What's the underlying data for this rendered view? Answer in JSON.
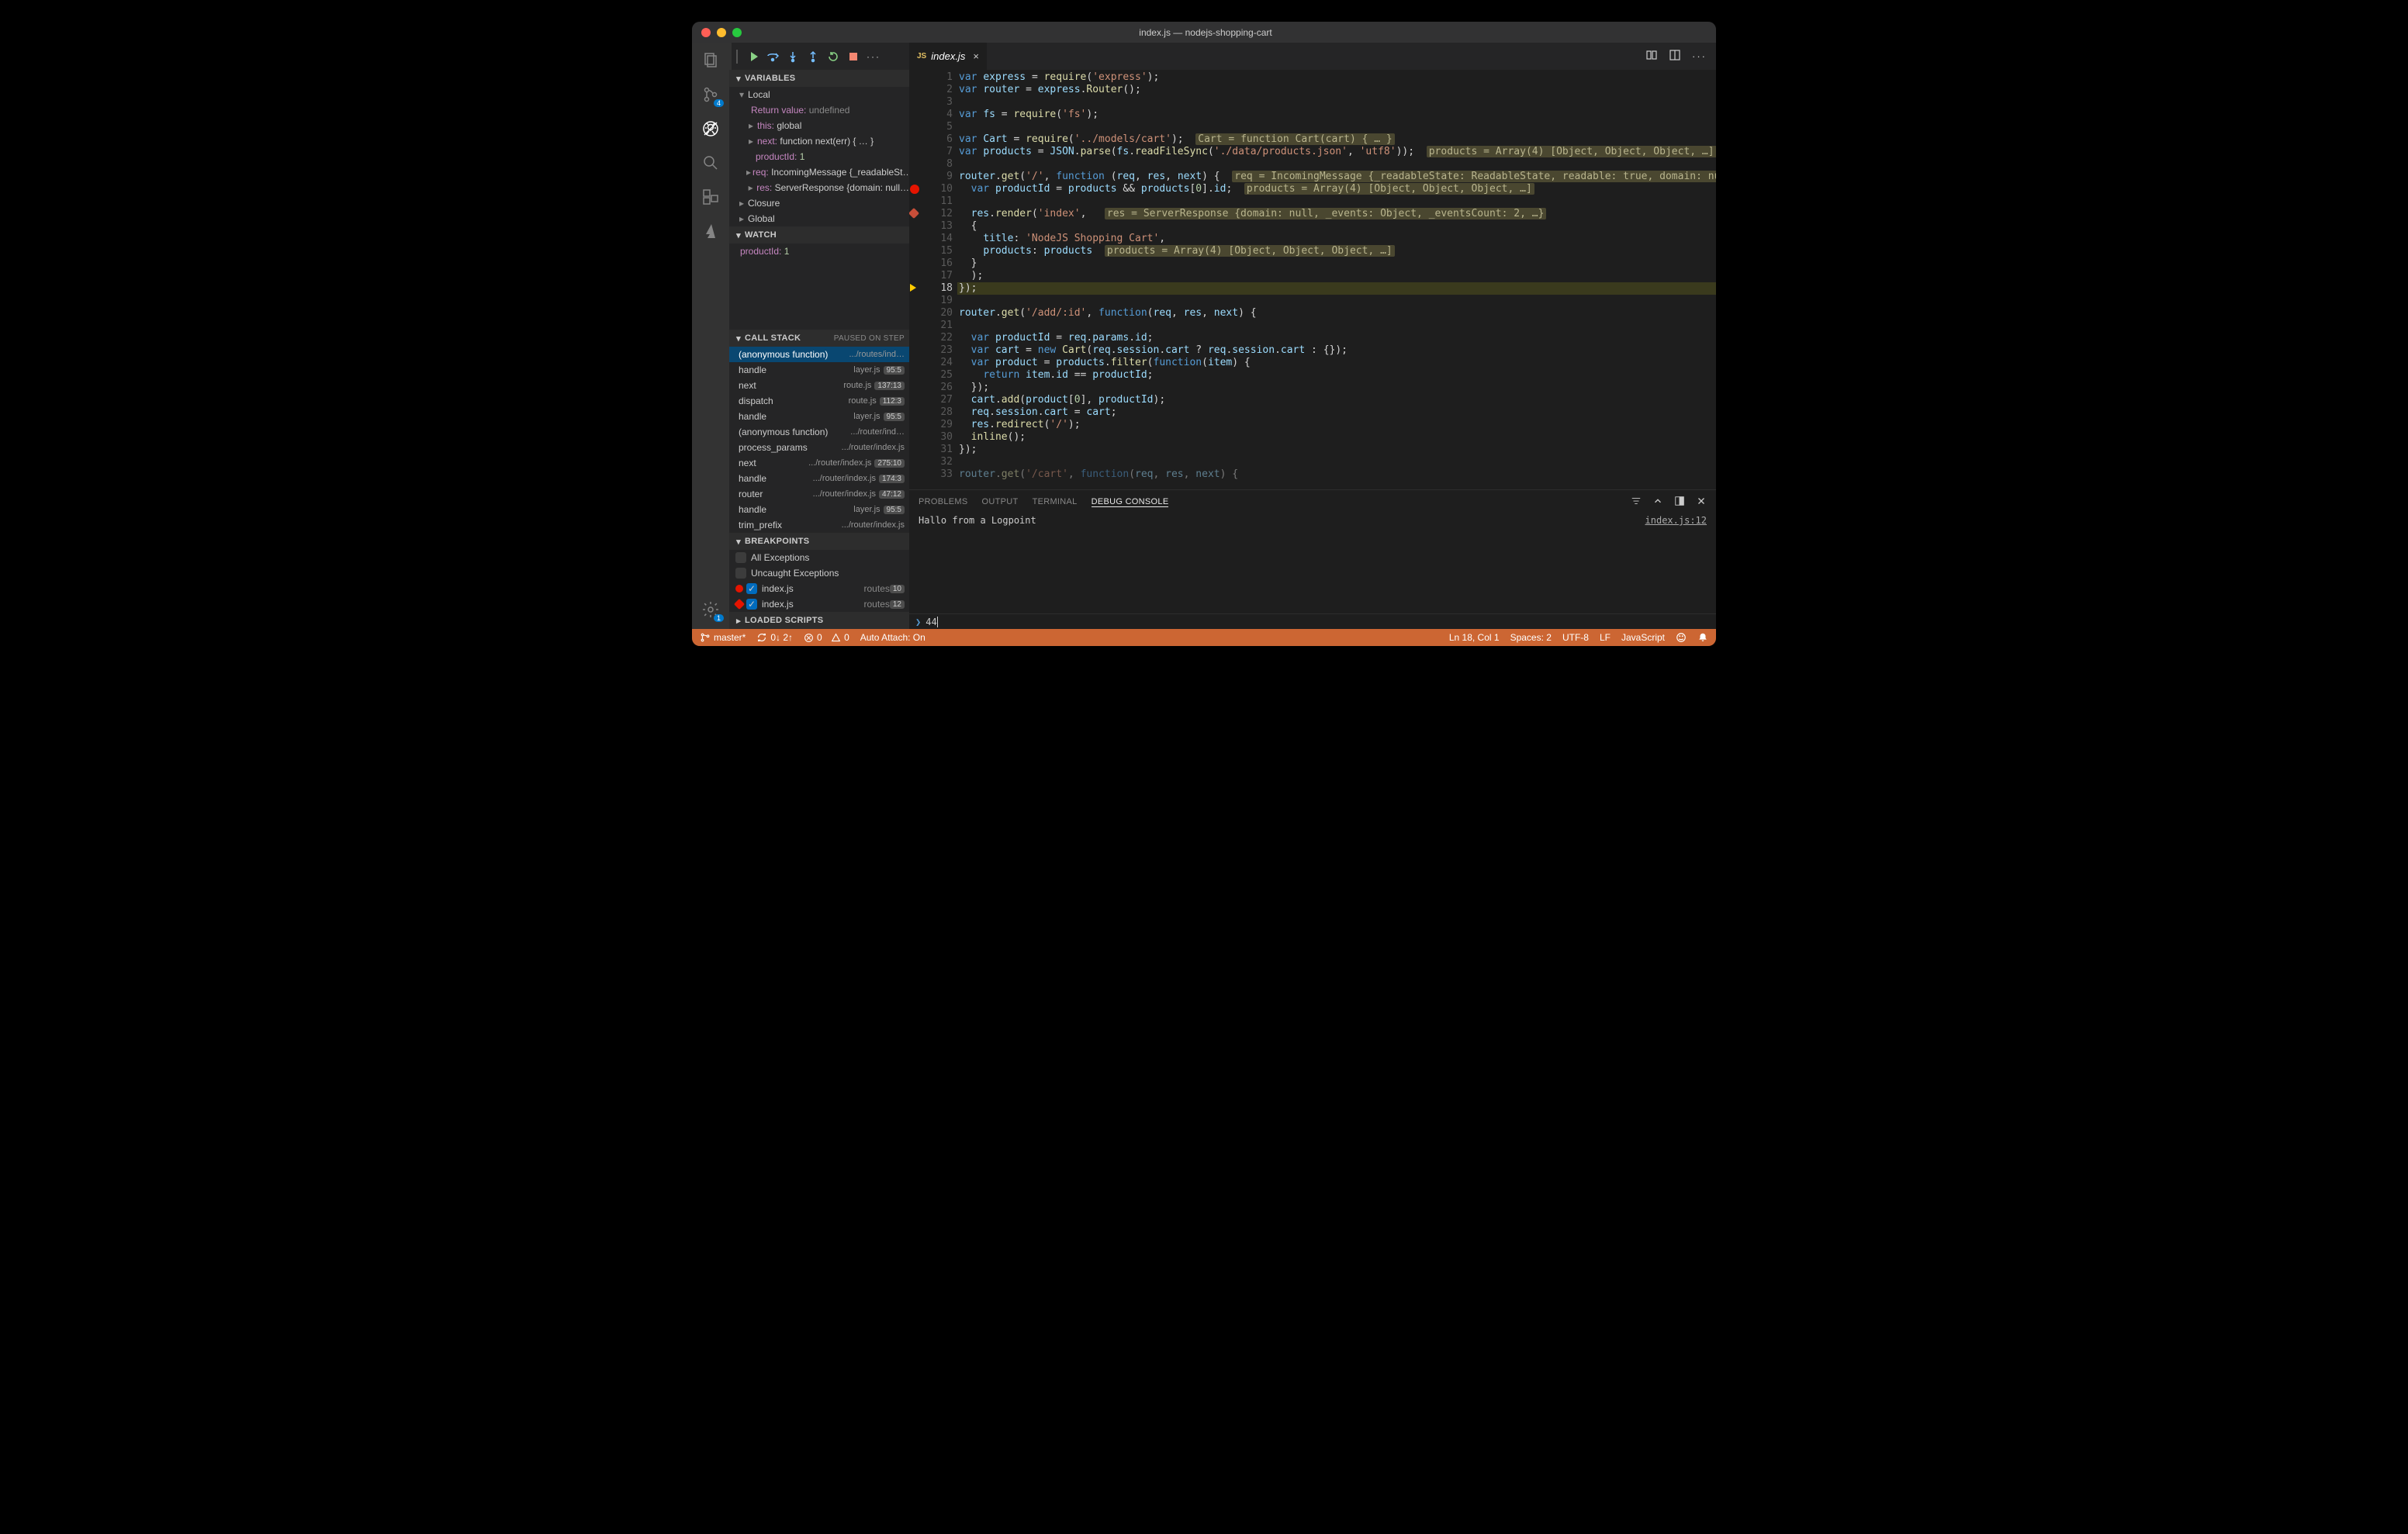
{
  "window": {
    "title": "index.js — nodejs-shopping-cart"
  },
  "activitybar": {
    "scm_badge": "4",
    "settings_badge": "1"
  },
  "debug_toolbar": {
    "more": "···"
  },
  "sidebar": {
    "variables": {
      "label": "VARIABLES",
      "local": "Local",
      "return_label": "Return value:",
      "return_val": "undefined",
      "this_label": "this:",
      "this_val": "global",
      "next_label": "next:",
      "next_val": "function next(err) { … }",
      "productId_label": "productId:",
      "productId_val": "1",
      "req_label": "req:",
      "req_val": "IncomingMessage {_readableSt…",
      "res_label": "res:",
      "res_val": "ServerResponse {domain: null…",
      "closure": "Closure",
      "global": "Global"
    },
    "watch": {
      "label": "WATCH",
      "item_name": "productId:",
      "item_val": "1"
    },
    "callstack": {
      "label": "CALL STACK",
      "aux": "PAUSED ON STEP",
      "rows": [
        {
          "fn": "(anonymous function)",
          "file": ".../routes/ind…",
          "ln": ""
        },
        {
          "fn": "handle",
          "file": "layer.js",
          "ln": "95:5"
        },
        {
          "fn": "next",
          "file": "route.js",
          "ln": "137:13"
        },
        {
          "fn": "dispatch",
          "file": "route.js",
          "ln": "112:3"
        },
        {
          "fn": "handle",
          "file": "layer.js",
          "ln": "95:5"
        },
        {
          "fn": "(anonymous function)",
          "file": ".../router/ind…",
          "ln": ""
        },
        {
          "fn": "process_params",
          "file": ".../router/index.js",
          "ln": ""
        },
        {
          "fn": "next",
          "file": ".../router/index.js",
          "ln": "275:10"
        },
        {
          "fn": "handle",
          "file": ".../router/index.js",
          "ln": "174:3"
        },
        {
          "fn": "router",
          "file": ".../router/index.js",
          "ln": "47:12"
        },
        {
          "fn": "handle",
          "file": "layer.js",
          "ln": "95:5"
        },
        {
          "fn": "trim_prefix",
          "file": ".../router/index.js",
          "ln": ""
        }
      ]
    },
    "breakpoints": {
      "label": "BREAKPOINTS",
      "all": "All Exceptions",
      "uncaught": "Uncaught Exceptions",
      "bp1_file": "index.js",
      "bp1_sub": "routes",
      "bp1_ln": "10",
      "bp2_file": "index.js",
      "bp2_sub": "routes",
      "bp2_ln": "12"
    },
    "loaded_scripts": "LOADED SCRIPTS"
  },
  "tab": {
    "js": "JS",
    "name": "index.js",
    "close": "×"
  },
  "editor": {
    "lines": [
      {
        "n": "1",
        "html": "<span class='kw'>var</span> <span class='ident'>express</span> <span class='punc'>=</span> <span class='fncall'>require</span><span class='punc'>(</span><span class='str'>'express'</span><span class='punc'>);</span>"
      },
      {
        "n": "2",
        "html": "<span class='kw'>var</span> <span class='ident'>router</span> <span class='punc'>=</span> <span class='ident'>express</span><span class='punc'>.</span><span class='fncall'>Router</span><span class='punc'>();</span>"
      },
      {
        "n": "3",
        "html": ""
      },
      {
        "n": "4",
        "html": "<span class='kw'>var</span> <span class='ident'>fs</span> <span class='punc'>=</span> <span class='fncall'>require</span><span class='punc'>(</span><span class='str'>'fs'</span><span class='punc'>);</span>"
      },
      {
        "n": "5",
        "html": ""
      },
      {
        "n": "6",
        "html": "<span class='kw'>var</span> <span class='ident'>Cart</span> <span class='punc'>=</span> <span class='fncall'>require</span><span class='punc'>(</span><span class='str'>'../models/cart'</span><span class='punc'>);</span>  <span class='inlay'>Cart = function Cart(cart) { … }</span>"
      },
      {
        "n": "7",
        "html": "<span class='kw'>var</span> <span class='ident'>products</span> <span class='punc'>=</span> <span class='ident'>JSON</span><span class='punc'>.</span><span class='fncall'>parse</span><span class='punc'>(</span><span class='ident'>fs</span><span class='punc'>.</span><span class='fncall'>readFileSync</span><span class='punc'>(</span><span class='str'>'./data/products.json'</span><span class='punc'>,</span> <span class='str'>'utf8'</span><span class='punc'>));</span>  <span class='inlay'>products = Array(4) [Object, Object, Object, …]</span>"
      },
      {
        "n": "8",
        "html": ""
      },
      {
        "n": "9",
        "html": "<span class='ident'>router</span><span class='punc'>.</span><span class='fncall'>get</span><span class='punc'>(</span><span class='str'>'/'</span><span class='punc'>,</span> <span class='kw'>function</span> <span class='punc'>(</span><span class='ident'>req</span><span class='punc'>,</span> <span class='ident'>res</span><span class='punc'>,</span> <span class='ident'>next</span><span class='punc'>) {</span>  <span class='inlay'>req = IncomingMessage {_readableState: ReadableState, readable: true, domain: null, …}, res = ServerRes</span>"
      },
      {
        "n": "10",
        "html": "  <span class='kw'>var</span> <span class='ident'>productId</span> <span class='punc'>=</span> <span class='ident'>products</span> <span class='punc'>&amp;&amp;</span> <span class='ident'>products</span><span class='punc'>[</span><span class='num'>0</span><span class='punc'>].</span><span class='ident'>id</span><span class='punc'>;</span>  <span class='inlay'>products = Array(4) [Object, Object, Object, …]</span>"
      },
      {
        "n": "11",
        "html": ""
      },
      {
        "n": "12",
        "html": "  <span class='ident'>res</span><span class='punc'>.</span><span class='fncall'>render</span><span class='punc'>(</span><span class='str'>'index'</span><span class='punc'>,</span>   <span class='inlay'>res = ServerResponse {domain: null, _events: Object, _eventsCount: 2, …}</span>"
      },
      {
        "n": "13",
        "html": "  <span class='punc'>{</span>"
      },
      {
        "n": "14",
        "html": "    <span class='ident'>title</span><span class='punc'>:</span> <span class='str'>'NodeJS Shopping Cart'</span><span class='punc'>,</span>"
      },
      {
        "n": "15",
        "html": "    <span class='ident'>products</span><span class='punc'>:</span> <span class='ident'>products</span>  <span class='inlay'>products = Array(4) [Object, Object, Object, …]</span>"
      },
      {
        "n": "16",
        "html": "  <span class='punc'>}</span>"
      },
      {
        "n": "17",
        "html": "  <span class='punc'>);</span>"
      },
      {
        "n": "18",
        "html": "<span class='punc'>});</span>"
      },
      {
        "n": "19",
        "html": ""
      },
      {
        "n": "20",
        "html": "<span class='ident'>router</span><span class='punc'>.</span><span class='fncall'>get</span><span class='punc'>(</span><span class='str'>'/add/:id'</span><span class='punc'>,</span> <span class='kw'>function</span><span class='punc'>(</span><span class='ident'>req</span><span class='punc'>,</span> <span class='ident'>res</span><span class='punc'>,</span> <span class='ident'>next</span><span class='punc'>) {</span>"
      },
      {
        "n": "21",
        "html": ""
      },
      {
        "n": "22",
        "html": "  <span class='kw'>var</span> <span class='ident'>productId</span> <span class='punc'>=</span> <span class='ident'>req</span><span class='punc'>.</span><span class='ident'>params</span><span class='punc'>.</span><span class='ident'>id</span><span class='punc'>;</span>"
      },
      {
        "n": "23",
        "html": "  <span class='kw'>var</span> <span class='ident'>cart</span> <span class='punc'>=</span> <span class='kw'>new</span> <span class='fncall'>Cart</span><span class='punc'>(</span><span class='ident'>req</span><span class='punc'>.</span><span class='ident'>session</span><span class='punc'>.</span><span class='ident'>cart</span> <span class='punc'>?</span> <span class='ident'>req</span><span class='punc'>.</span><span class='ident'>session</span><span class='punc'>.</span><span class='ident'>cart</span> <span class='punc'>:</span> <span class='punc'>{});</span>"
      },
      {
        "n": "24",
        "html": "  <span class='kw'>var</span> <span class='ident'>product</span> <span class='punc'>=</span> <span class='ident'>products</span><span class='punc'>.</span><span class='fncall'>filter</span><span class='punc'>(</span><span class='kw'>function</span><span class='punc'>(</span><span class='ident'>item</span><span class='punc'>) {</span>"
      },
      {
        "n": "25",
        "html": "    <span class='kw'>return</span> <span class='ident'>item</span><span class='punc'>.</span><span class='ident'>id</span> <span class='punc'>==</span> <span class='ident'>productId</span><span class='punc'>;</span>"
      },
      {
        "n": "26",
        "html": "  <span class='punc'>});</span>"
      },
      {
        "n": "27",
        "html": "  <span class='ident'>cart</span><span class='punc'>.</span><span class='fncall'>add</span><span class='punc'>(</span><span class='ident'>product</span><span class='punc'>[</span><span class='num'>0</span><span class='punc'>],</span> <span class='ident'>productId</span><span class='punc'>);</span>"
      },
      {
        "n": "28",
        "html": "  <span class='ident'>req</span><span class='punc'>.</span><span class='ident'>session</span><span class='punc'>.</span><span class='ident'>cart</span> <span class='punc'>=</span> <span class='ident'>cart</span><span class='punc'>;</span>"
      },
      {
        "n": "29",
        "html": "  <span class='ident'>res</span><span class='punc'>.</span><span class='fncall'>redirect</span><span class='punc'>(</span><span class='str'>'/'</span><span class='punc'>);</span>"
      },
      {
        "n": "30",
        "html": "  <span class='fncall'>inline</span><span class='punc'>();</span>"
      },
      {
        "n": "31",
        "html": "<span class='punc'>});</span>"
      },
      {
        "n": "32",
        "html": ""
      },
      {
        "n": "33",
        "html": "<span class='ident' style='opacity:.5'>router</span><span class='punc' style='opacity:.5'>.</span><span class='fncall' style='opacity:.5'>get</span><span class='punc' style='opacity:.5'>(</span><span class='str' style='opacity:.5'>'/cart'</span><span class='punc' style='opacity:.5'>,</span> <span class='kw' style='opacity:.5'>function</span><span class='punc' style='opacity:.5'>(</span><span class='ident' style='opacity:.5'>req</span><span class='punc' style='opacity:.5'>,</span> <span class='ident' style='opacity:.5'>res</span><span class='punc' style='opacity:.5'>,</span> <span class='ident' style='opacity:.5'>next</span><span class='punc' style='opacity:.5'>) {</span>"
      }
    ],
    "glyphs": [
      {
        "line": 10,
        "color": "#e51400"
      },
      {
        "line": 12,
        "color": "#c74e39",
        "shape": "diamond"
      }
    ],
    "current_arrow_line": 18,
    "highlight_line": 18
  },
  "panel": {
    "tabs": {
      "problems": "PROBLEMS",
      "output": "OUTPUT",
      "terminal": "TERMINAL",
      "debug": "DEBUG CONSOLE"
    },
    "message": "Hallo from a Logpoint",
    "source": "index.js:12",
    "repl_value": "44"
  },
  "status": {
    "branch": "master*",
    "sync": "0↓ 2↑",
    "errors": "0",
    "warnings": "0",
    "auto_attach": "Auto Attach: On",
    "ln_col": "Ln 18, Col 1",
    "spaces": "Spaces: 2",
    "encoding": "UTF-8",
    "eol": "LF",
    "lang": "JavaScript"
  }
}
